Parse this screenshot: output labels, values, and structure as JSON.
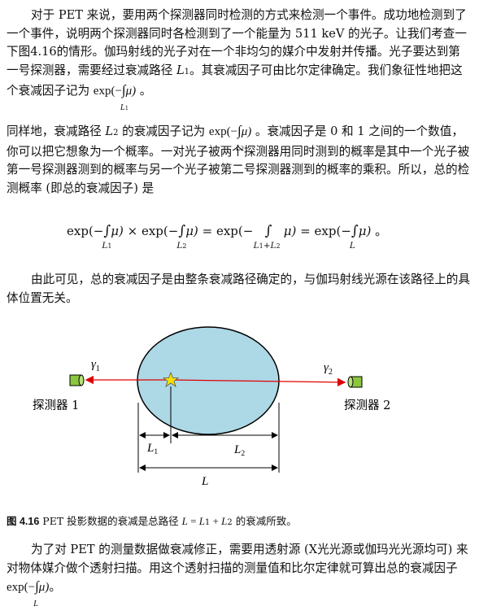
{
  "para1": {
    "text_a": "对于 PET 来说，要用两个探测器同时检测的方式来检测一个事件。成功地检测到了一个事件，说明两个探测器同时各检测到了一个能量为 511 keV 的光子。让我们考查一下图4.16的情形。伽玛射线的光子对在一个非均匀的媒介中发射并传播。光子要达到第一号探测器，需要经过衰减路径 ",
    "path1_symbol": "L",
    "path1_sub": "1",
    "text_b": "。其衰减因子可由比尔定律确定。我们象征性地把这个衰减因子记为 ",
    "text_c": " 。"
  },
  "para2": {
    "text_a": "同样地，衰减路径 ",
    "path2_symbol": "L",
    "path2_sub": "2",
    "text_b": " 的衰减因子记为 ",
    "text_c": " 。衰减因子是 0 和 1 之间的一个数值，你可以把它想象为一个概率。一对光子被两个探测器用同时测到的概率是其中一个光子被第一号探测器测到的概率与另一个光子被第二号探测器测到的概率的乘积。所以，总的检测概率 (即总的衰减因子) 是"
  },
  "math": {
    "exp_open": "exp(−",
    "integral": "∫",
    "mu_close": "μ)",
    "times": "×",
    "equals": "=",
    "plus": "+",
    "period": "。",
    "L": "L",
    "one": "1",
    "two": "2"
  },
  "para3": {
    "text": "由此可见，总的衰减因子是由整条衰减路径确定的，与伽玛射线光源在该路径上的具体位置无关。"
  },
  "diagram": {
    "gamma1": "γ",
    "gamma1_sub": "1",
    "gamma2": "γ",
    "gamma2_sub": "2",
    "detector1_label": "探测器 1",
    "detector2_label": "探测器 2",
    "L1": "L",
    "L1_sub": "1",
    "L2": "L",
    "L2_sub": "2",
    "L_total": "L",
    "colors": {
      "ellipse_fill": "#add8e6",
      "ray": "#e00000",
      "detector": "#8cc63f",
      "source_star": "#f5e000"
    }
  },
  "caption": {
    "figure": "图 4.16",
    "text_a": " PET 投影数据的衰减是总路径 ",
    "L": "L",
    "eq": " = ",
    "L1": "L",
    "L1_sub": "1",
    "plus": " + ",
    "L2": "L",
    "L2_sub": "2",
    "text_b": " 的衰减所致。"
  },
  "para4": {
    "text_a": "为了对 PET 的测量数据做衰减修正，需要用透射源 (X光光源或伽玛光光源均可) 来对物体媒介做个透射扫描。用这个透射扫描的测量值和比尔定律就可算出总的衰减因子 ",
    "text_b": "。"
  }
}
